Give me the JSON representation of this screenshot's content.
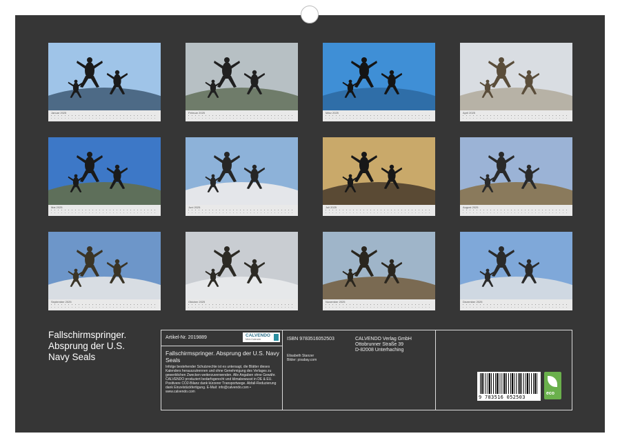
{
  "calendar": {
    "title_lines": [
      "Fallschirmspringer.",
      "Absprung der U.S.",
      "Navy Seals"
    ],
    "months": [
      {
        "label": "Januar 2025"
      },
      {
        "label": "Februar 2025"
      },
      {
        "label": "März 2025"
      },
      {
        "label": "April 2025"
      },
      {
        "label": "Mai 2025"
      },
      {
        "label": "Juni 2025"
      },
      {
        "label": "Juli 2025"
      },
      {
        "label": "August 2025"
      },
      {
        "label": "September 2025"
      },
      {
        "label": "Oktober 2025"
      },
      {
        "label": "November 2025"
      },
      {
        "label": "Dezember 2025"
      }
    ],
    "photo_palettes": [
      {
        "sky": "#9fc4e8",
        "ground": "#4d6a86",
        "figure": "#1a1a1a"
      },
      {
        "sky": "#b7c0c4",
        "ground": "#6f7c6a",
        "figure": "#202020"
      },
      {
        "sky": "#3f8fd6",
        "ground": "#2f6ea8",
        "figure": "#141414"
      },
      {
        "sky": "#d9dde2",
        "ground": "#b7b2a6",
        "figure": "#5a4d3a"
      },
      {
        "sky": "#3d78c7",
        "ground": "#5e6f5a",
        "figure": "#1a1a1a"
      },
      {
        "sky": "#8db2d9",
        "ground": "#e4e6ea",
        "figure": "#262626"
      },
      {
        "sky": "#c9a96a",
        "ground": "#5a4a34",
        "figure": "#181818"
      },
      {
        "sky": "#9bb3d6",
        "ground": "#8a7a5c",
        "figure": "#2a2a2a"
      },
      {
        "sky": "#6d96c9",
        "ground": "#d8dde3",
        "figure": "#3a3426"
      },
      {
        "sky": "#c9cdd2",
        "ground": "#e6e8ea",
        "figure": "#2c2a24"
      },
      {
        "sky": "#9fb5c9",
        "ground": "#7a6a52",
        "figure": "#2a261e"
      },
      {
        "sky": "#7fa8d9",
        "ground": "#cfd8e2",
        "figure": "#2a2a2a"
      }
    ]
  },
  "info": {
    "article": "Artikel-Nr. 2019889",
    "title": "Fallschirmspringer. Absprung der U.S. Navy Seals",
    "legal": "Infolge bestehender Schutzrechte ist es untersagt, die Blätter dieses Kalenders herauszutrennen und ohne Genehmigung des Verlages zu gewerblichen Zwecken weiterzuverwenden. Alle Angaben ohne Gewähr. CALVENDO produziert bedarfsgerecht und klimabewusst in DE & EU. Positivere CO2-Bilanz dank kürzerer Transportwege. Abfall-Reduzierung dank Einzelstückfertigung. E-Mail: info@calvendo.com • www.calvendo.com",
    "logo_text": "CALVENDO",
    "logo_sub": "Mein Kalender",
    "isbn": "ISBN 9783516052503",
    "author": "Elisabeth Stanzer",
    "credits": "Bilder: pixabay.com",
    "publisher_lines": [
      "CALVENDO Verlag GmbH",
      "Ottobrunner Straße 39",
      "D-82008 Unterhaching"
    ],
    "barcode_number": "9 783516 052503",
    "eco_label": "eco"
  }
}
